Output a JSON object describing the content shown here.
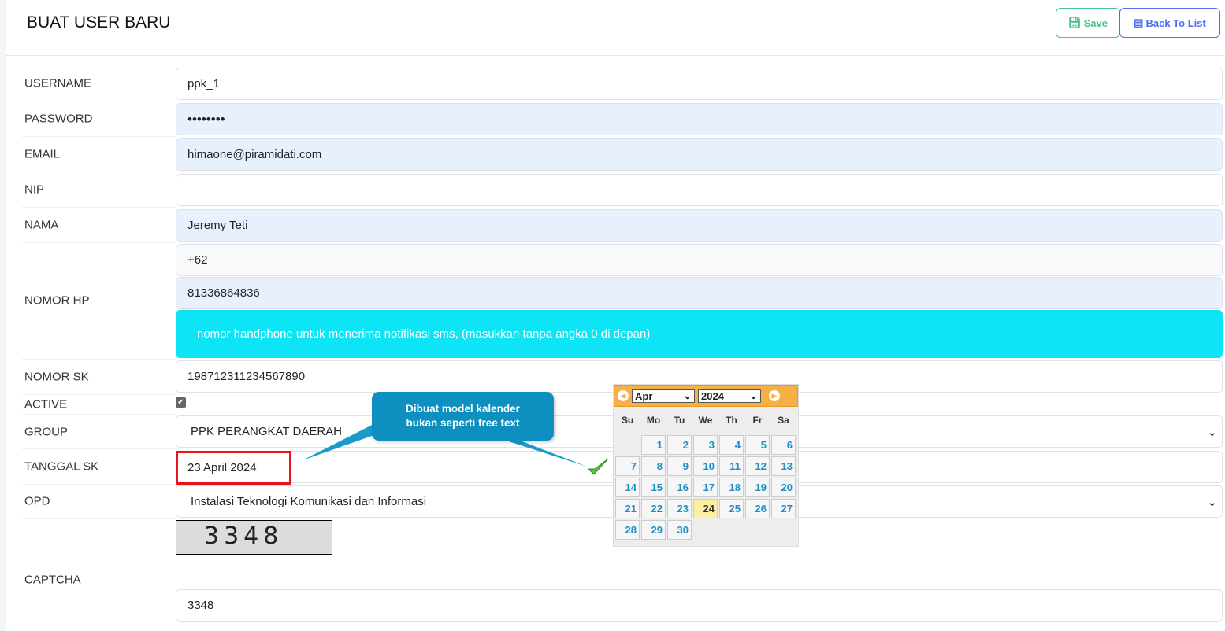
{
  "header": {
    "title": "BUAT USER BARU",
    "save_label": "Save",
    "back_label": "Back To List"
  },
  "form": {
    "username": {
      "label": "USERNAME",
      "value": "ppk_1"
    },
    "password": {
      "label": "PASSWORD",
      "value": "••••••••"
    },
    "email": {
      "label": "EMAIL",
      "value": "himaone@piramidati.com"
    },
    "nip": {
      "label": "NIP",
      "value": ""
    },
    "nama": {
      "label": "NAMA",
      "value": "Jeremy Teti"
    },
    "nomor_hp": {
      "label": "NOMOR HP",
      "prefix": "+62",
      "value": "81336864836",
      "help": "nomor handphone untuk menerima notifikasi sms, (masukkan tanpa angka 0 di depan)"
    },
    "nomor_sk": {
      "label": "NOMOR SK",
      "value": "198712311234567890"
    },
    "active": {
      "label": "ACTIVE",
      "checked": true
    },
    "group": {
      "label": "GROUP",
      "value": "PPK PERANGKAT DAERAH"
    },
    "tanggal_sk": {
      "label": "TANGGAL SK",
      "value": "23 April 2024"
    },
    "opd": {
      "label": "OPD",
      "value": "Instalasi Teknologi Komunikasi dan Informasi"
    },
    "captcha": {
      "label": "CAPTCHA",
      "image_text": "3348",
      "value": "3348"
    }
  },
  "annotation": {
    "line1": "Dibuat model kalender",
    "line2": "bukan seperti free text"
  },
  "calendar": {
    "month": "Apr",
    "year": "2024",
    "weekdays": [
      "Su",
      "Mo",
      "Tu",
      "We",
      "Th",
      "Fr",
      "Sa"
    ],
    "start_offset": 1,
    "days": 30,
    "highlighted": 24
  }
}
